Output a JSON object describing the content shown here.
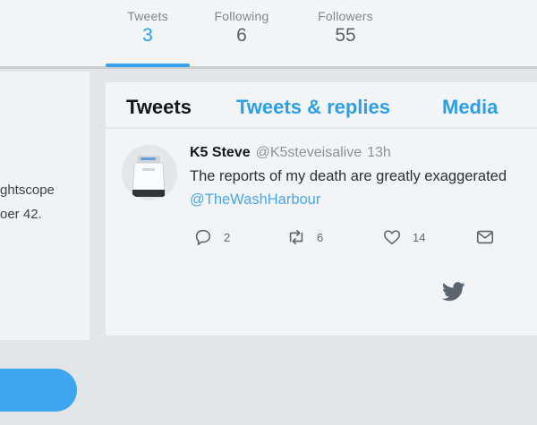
{
  "stats": [
    {
      "label": "Tweets",
      "value": "3"
    },
    {
      "label": "Following",
      "value": "6"
    },
    {
      "label": "Followers",
      "value": "55"
    }
  ],
  "left_card": {
    "line1": "ghtscope",
    "line2": "oer 42."
  },
  "tabs": [
    "Tweets",
    "Tweets & replies",
    "Media"
  ],
  "tweet": {
    "name": "K5 Steve",
    "handle": "@K5steveisalive",
    "time": "13h",
    "text": "The reports of my death are greatly exaggerated",
    "mention": "@TheWashHarbour",
    "actions": {
      "reply": "2",
      "retweet": "6",
      "like": "14"
    }
  },
  "colors": {
    "accent": "#1da1f2",
    "link": "#2c9fe6",
    "button": "#3ea6ef"
  },
  "icons": {
    "reply": "reply-icon",
    "retweet": "retweet-icon",
    "like": "heart-icon",
    "dm": "envelope-icon",
    "brand": "twitter-bird-icon"
  }
}
